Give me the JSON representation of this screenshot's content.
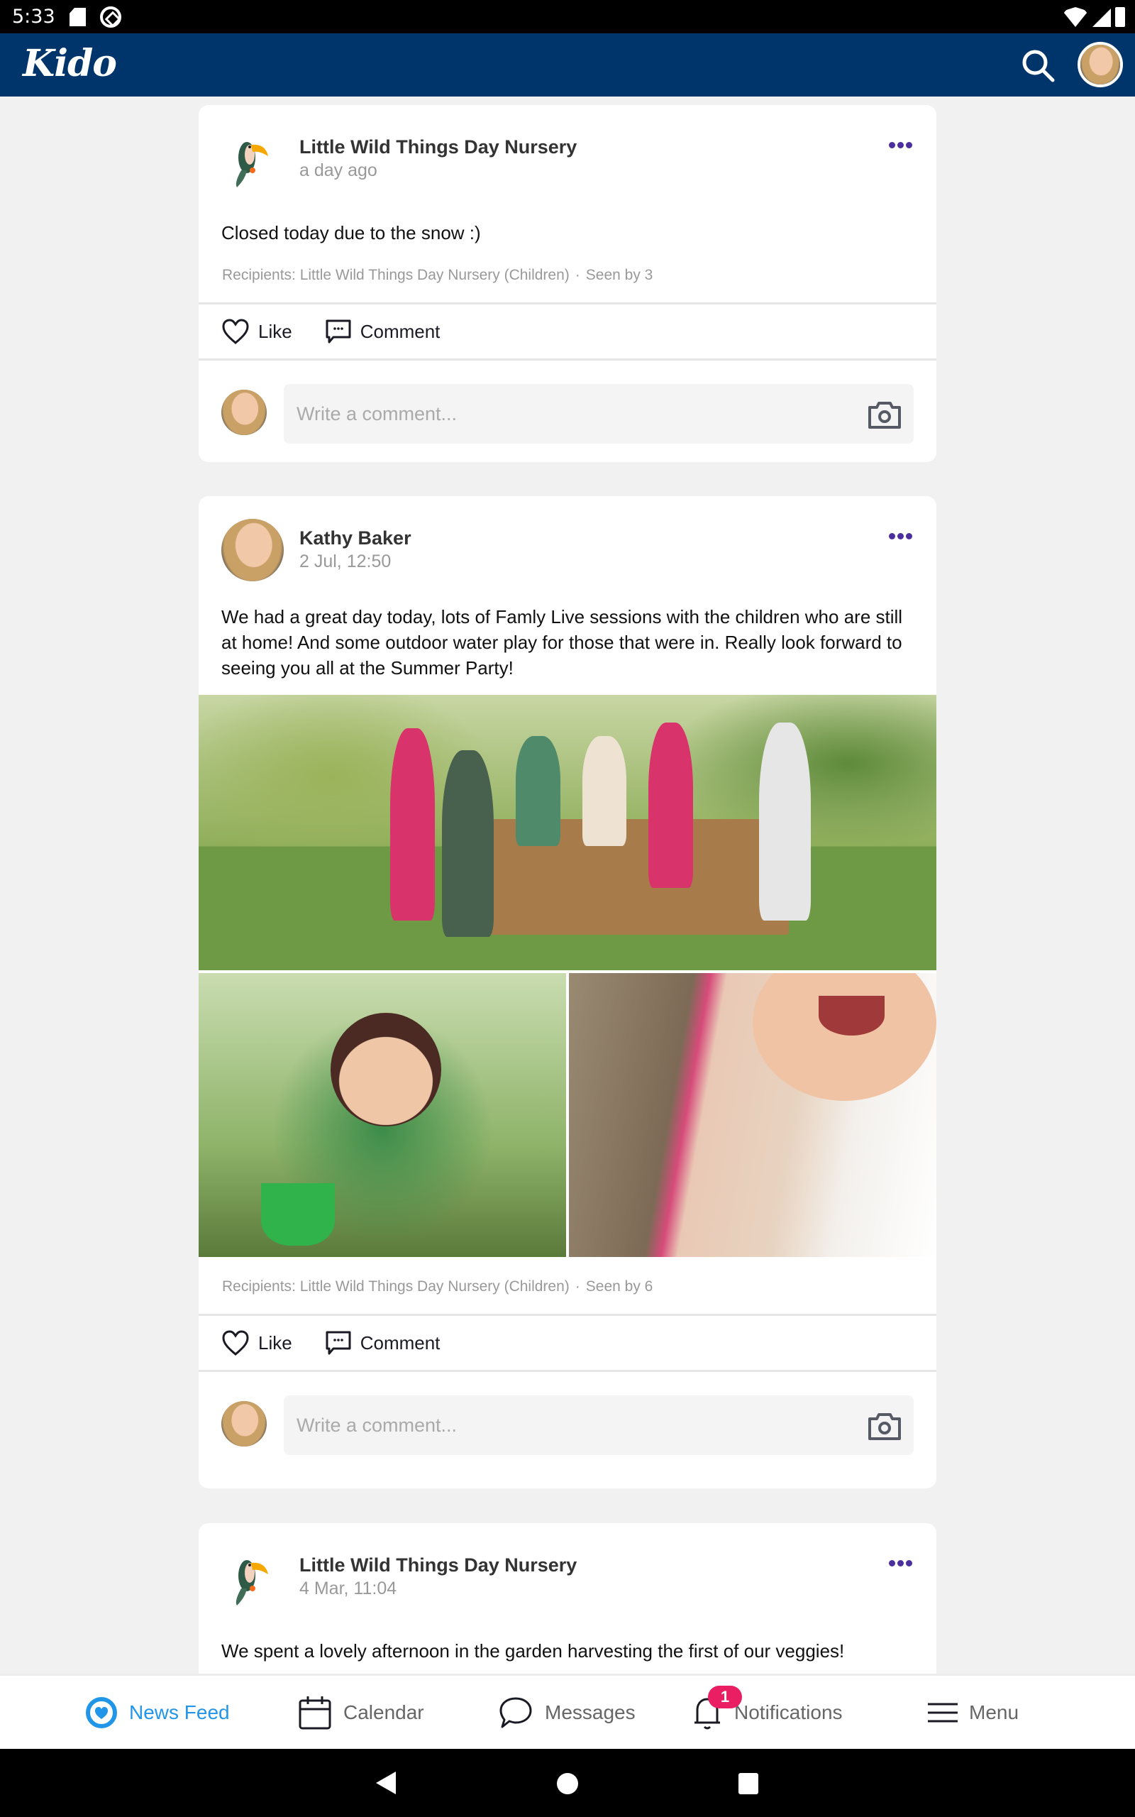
{
  "status_bar": {
    "time": "5:33",
    "icons": [
      "sd-card-icon",
      "sync-icon",
      "wifi-icon",
      "cell-signal-icon",
      "battery-icon"
    ]
  },
  "app_bar": {
    "logo": "Kido",
    "search_icon": "search-icon",
    "profile_avatar": "user-avatar"
  },
  "posts": [
    {
      "author": "Little Wild Things Day Nursery",
      "avatar": "toucan-logo",
      "time": "a day ago",
      "text": "Closed today due to the snow :)",
      "recipients": "Recipients: Little Wild Things Day Nursery (Children)",
      "seen_by": "Seen by 3",
      "like_label": "Like",
      "comment_label": "Comment",
      "comment_placeholder": "Write a comment..."
    },
    {
      "author": "Kathy Baker",
      "avatar": "kathy-baker-photo",
      "time": "2 Jul, 12:50",
      "text": "We had a great day today, lots of Famly Live sessions with the children who are still at home! And some outdoor water play for those that were in. Really look forward to seeing you all at the Summer Party!",
      "photos": [
        "children-at-water-play-table",
        "girl-with-green-bucket",
        "smiling-child-with-sand"
      ],
      "recipients": "Recipients: Little Wild Things Day Nursery (Children)",
      "seen_by": "Seen by 6",
      "like_label": "Like",
      "comment_label": "Comment",
      "comment_placeholder": "Write a comment..."
    },
    {
      "author": "Little Wild Things Day Nursery",
      "avatar": "toucan-logo",
      "time": "4 Mar, 11:04",
      "text": "We spent a lovely afternoon in the garden harvesting the first of our veggies!"
    }
  ],
  "bottom_nav": {
    "items": [
      {
        "label": "News Feed",
        "icon": "news-feed-icon",
        "active": true
      },
      {
        "label": "Calendar",
        "icon": "calendar-icon"
      },
      {
        "label": "Messages",
        "icon": "messages-icon"
      },
      {
        "label": "Notifications",
        "icon": "bell-icon",
        "badge": "1"
      },
      {
        "label": "Menu",
        "icon": "hamburger-icon"
      }
    ]
  },
  "colors": {
    "app_bar": "#00356b",
    "accent": "#2196e8",
    "more_dots": "#4b2f9f",
    "badge": "#e91e63",
    "background": "#f1f1f1"
  }
}
